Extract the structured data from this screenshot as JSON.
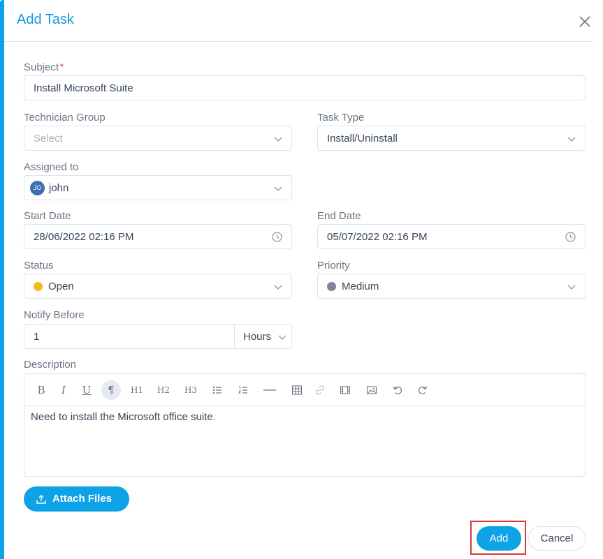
{
  "dialog": {
    "title": "Add Task"
  },
  "form": {
    "subject": {
      "label": "Subject",
      "required_mark": "*",
      "value": "Install Microsoft Suite"
    },
    "technician_group": {
      "label": "Technician Group",
      "placeholder": "Select"
    },
    "task_type": {
      "label": "Task Type",
      "value": "Install/Uninstall"
    },
    "assigned_to": {
      "label": "Assigned to",
      "avatar_initials": "JO",
      "value": "john"
    },
    "start_date": {
      "label": "Start Date",
      "value": "28/06/2022 02:16 PM"
    },
    "end_date": {
      "label": "End Date",
      "value": "05/07/2022 02:16 PM"
    },
    "status": {
      "label": "Status",
      "value": "Open",
      "color": "#f5b820"
    },
    "priority": {
      "label": "Priority",
      "value": "Medium",
      "color": "#7b8798"
    },
    "notify_before": {
      "label": "Notify Before",
      "value": "1",
      "unit": "Hours"
    },
    "description": {
      "label": "Description",
      "content": "Need to install the Microsoft office suite.",
      "toolbar": {
        "bold": "B",
        "italic": "I",
        "underline": "U",
        "paragraph": "¶",
        "h1": "H1",
        "h2": "H2",
        "h3": "H3"
      }
    }
  },
  "actions": {
    "attach_files": "Attach Files",
    "add": "Add",
    "cancel": "Cancel"
  },
  "colors": {
    "accent": "#0ea2e6",
    "title": "#1798d9",
    "highlight_border": "#e0353d"
  }
}
